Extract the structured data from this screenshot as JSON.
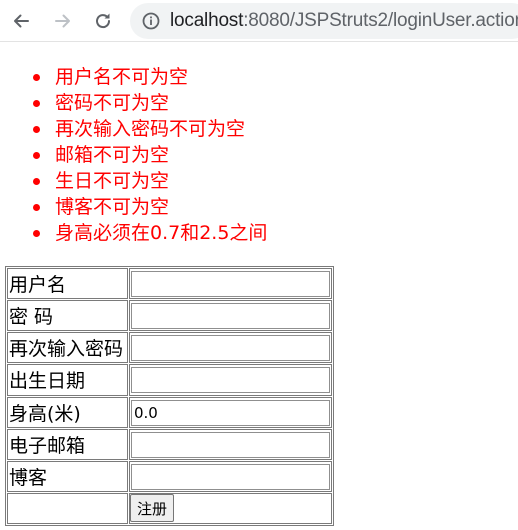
{
  "browser": {
    "url_host": "localhost",
    "url_rest": ":8080/JSPStruts2/loginUser.action",
    "icons": [
      "back-arrow-icon",
      "forward-arrow-icon",
      "reload-icon",
      "info-icon"
    ]
  },
  "errors": [
    "用户名不可为空",
    "密码不可为空",
    "再次输入密码不可为空",
    "邮箱不可为空",
    "生日不可为空",
    "博客不可为空",
    "身高必须在0.7和2.5之间"
  ],
  "form": {
    "fields": [
      {
        "label": "用户名",
        "value": ""
      },
      {
        "label": "密 码",
        "value": ""
      },
      {
        "label": "再次输入密码",
        "value": ""
      },
      {
        "label": "出生日期",
        "value": ""
      },
      {
        "label": "身高(米)",
        "value": "0.0"
      },
      {
        "label": "电子邮箱",
        "value": ""
      },
      {
        "label": "博客",
        "value": ""
      }
    ],
    "submit_label": "注册"
  },
  "colors": {
    "error_text": "#ff0000",
    "omnibox_bg": "#f1f3f4",
    "icon_gray": "#5f6368"
  }
}
